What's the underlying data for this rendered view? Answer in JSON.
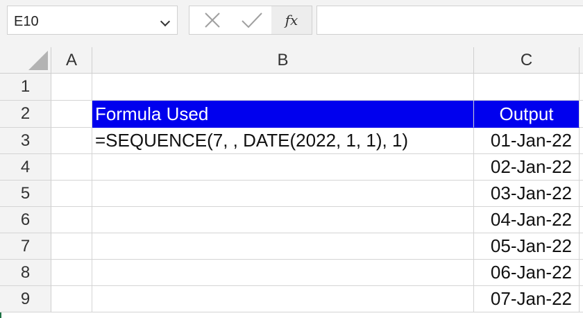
{
  "name_box": {
    "value": "E10"
  },
  "formula_bar": {
    "fx_label": "fx",
    "value": ""
  },
  "columns": [
    "A",
    "B",
    "C"
  ],
  "rows": [
    "1",
    "2",
    "3",
    "4",
    "5",
    "6",
    "7",
    "8",
    "9"
  ],
  "table": {
    "header": {
      "formula": "Formula Used",
      "output": "Output"
    },
    "formula_text": "=SEQUENCE(7, , DATE(2022, 1, 1), 1)",
    "outputs": [
      "01-Jan-22",
      "02-Jan-22",
      "03-Jan-22",
      "04-Jan-22",
      "05-Jan-22",
      "06-Jan-22",
      "07-Jan-22"
    ]
  },
  "colors": {
    "header_fill": "#0000ee",
    "header_text": "#ffffff"
  }
}
